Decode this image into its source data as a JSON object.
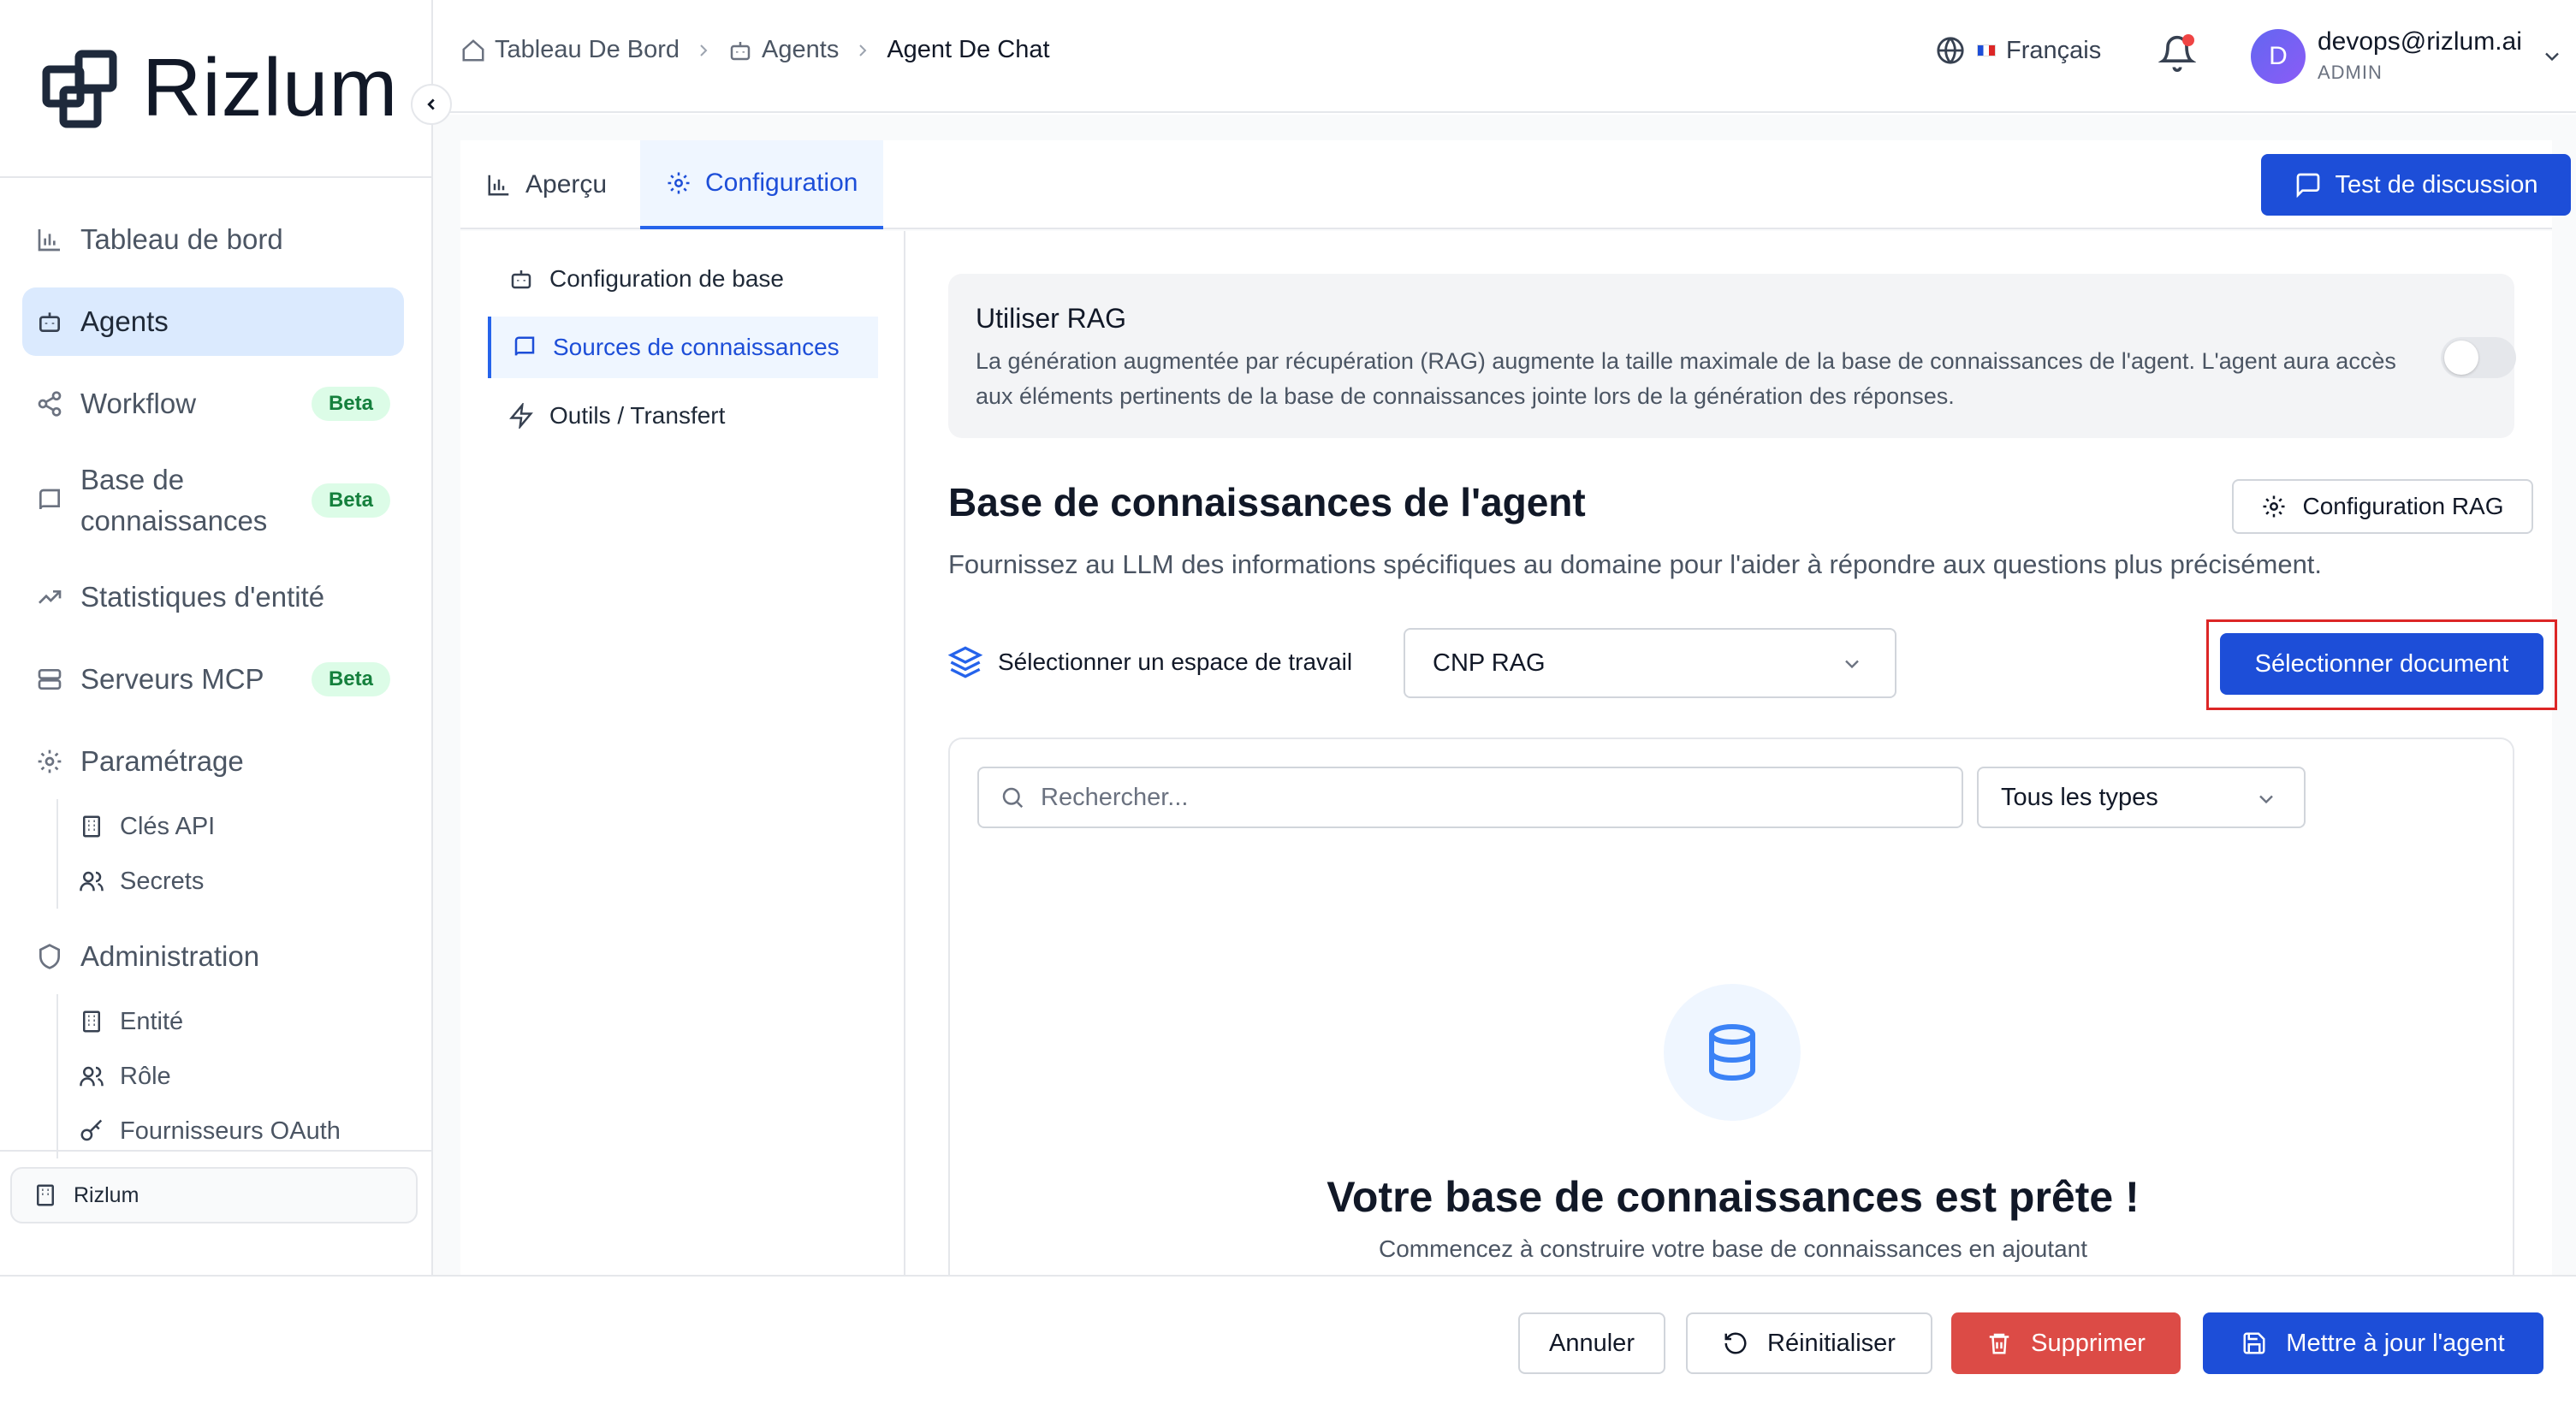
{
  "app": {
    "brand": "Rizlum",
    "org": "Rizlum"
  },
  "sidebar": {
    "items": [
      {
        "label": "Tableau de bord",
        "icon": "bar-chart-icon"
      },
      {
        "label": "Agents",
        "icon": "bot-icon",
        "active": true
      },
      {
        "label": "Workflow",
        "icon": "share-icon",
        "badge": "Beta"
      },
      {
        "label": "Base de connaissances",
        "icon": "book-icon",
        "badge": "Beta"
      },
      {
        "label": "Statistiques d'entité",
        "icon": "trending-up-icon"
      },
      {
        "label": "Serveurs MCP",
        "icon": "server-icon",
        "badge": "Beta"
      },
      {
        "label": "Paramétrage",
        "icon": "gear-icon"
      },
      {
        "label": "Administration",
        "icon": "shield-icon"
      }
    ],
    "settings_sub": [
      {
        "label": "Clés API",
        "icon": "building-icon"
      },
      {
        "label": "Secrets",
        "icon": "users-icon"
      }
    ],
    "admin_sub": [
      {
        "label": "Entité",
        "icon": "building-icon"
      },
      {
        "label": "Rôle",
        "icon": "users-icon"
      },
      {
        "label": "Fournisseurs OAuth",
        "icon": "key-icon"
      }
    ]
  },
  "header": {
    "breadcrumb": [
      "Tableau De Bord",
      "Agents",
      "Agent De Chat"
    ],
    "language": "Français",
    "user_initial": "D",
    "user_email": "devops@rizlum.ai",
    "user_role": "ADMIN"
  },
  "tabs": [
    {
      "label": "Aperçu",
      "icon": "bar-chart-icon"
    },
    {
      "label": "Configuration",
      "icon": "gear-icon",
      "active": true
    }
  ],
  "test_button": "Test de discussion",
  "subnav": [
    {
      "label": "Configuration de base",
      "icon": "bot-icon"
    },
    {
      "label": "Sources de connaissances",
      "icon": "book-icon",
      "active": true
    },
    {
      "label": "Outils / Transfert",
      "icon": "zap-icon"
    }
  ],
  "rag": {
    "title": "Utiliser RAG",
    "description": "La génération augmentée par récupération (RAG) augmente la taille maximale de la base de connaissances de l'agent. L'agent aura accès aux éléments pertinents de la base de connaissances jointe lors de la génération des réponses.",
    "enabled": false
  },
  "knowledge": {
    "title": "Base de connaissances de l'agent",
    "description": "Fournissez au LLM des informations spécifiques au domaine pour l'aider à répondre aux questions plus précisément.",
    "rag_config_button": "Configuration RAG",
    "workspace_label": "Sélectionner un espace de travail",
    "workspace_value": "CNP RAG",
    "select_document_button": "Sélectionner document",
    "search_placeholder": "Rechercher...",
    "type_filter": "Tous les types",
    "empty_title": "Votre base de connaissances est prête !",
    "empty_subtitle": "Commencez à construire votre base de connaissances en ajoutant"
  },
  "footer": {
    "cancel": "Annuler",
    "reset": "Réinitialiser",
    "delete": "Supprimer",
    "update": "Mettre à jour l'agent"
  },
  "colors": {
    "primary": "#1d4ed8",
    "danger": "#dc4b46",
    "highlight": "#dc2626"
  }
}
